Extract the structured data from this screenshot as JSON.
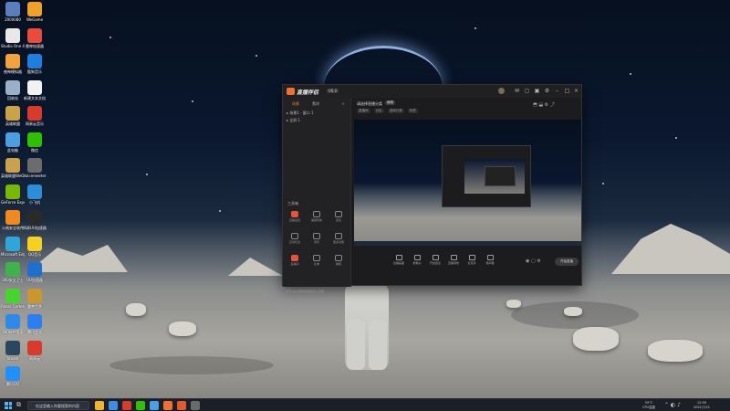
{
  "desktop": {
    "icons": [
      {
        "label": "2000080",
        "color": "#5a7fbf"
      },
      {
        "label": "Studio One 4",
        "color": "#e8e8e8"
      },
      {
        "label": "夜神模拟器",
        "color": "#f2a43a"
      },
      {
        "label": "回收站",
        "color": "#9ab0c8"
      },
      {
        "label": "英雄联盟",
        "color": "#c9a24a"
      },
      {
        "label": "此电脑",
        "color": "#4a9fe0"
      },
      {
        "label": "英雄联盟WeGame版",
        "color": "#c9a24a"
      },
      {
        "label": "GeForce Experience",
        "color": "#76b900"
      },
      {
        "label": "火绒安全软件",
        "color": "#f08a1e"
      },
      {
        "label": "Microsoft Edge",
        "color": "#2fa6d9"
      },
      {
        "label": "360安全卫士",
        "color": "#3db34a"
      },
      {
        "label": "Razer Cortex",
        "color": "#44d62c"
      },
      {
        "label": "360软件管家",
        "color": "#2e8ae6"
      },
      {
        "label": "Steam",
        "color": "#2a475e"
      },
      {
        "label": "腾讯QQ",
        "color": "#1e90ff"
      },
      {
        "label": "WeGame",
        "color": "#f0a12a"
      },
      {
        "label": "雷神加速器",
        "color": "#e94b3c"
      },
      {
        "label": "酷狗音乐",
        "color": "#1e7fe0"
      },
      {
        "label": "新建文本文档",
        "color": "#f2f2f2"
      },
      {
        "label": "网易云音乐",
        "color": "#d83b2b"
      },
      {
        "label": "微信",
        "color": "#2dc100"
      },
      {
        "label": "Voicemeeter",
        "color": "#6c6c6c"
      },
      {
        "label": "小飞机",
        "color": "#2a8fd6"
      },
      {
        "label": "网易UU加速器",
        "color": "#2a2a2a"
      },
      {
        "label": "QQ音乐",
        "color": "#f5d020"
      },
      {
        "label": "UU加速器",
        "color": "#1f6fd0"
      },
      {
        "label": "魔兽世界",
        "color": "#c9972d"
      },
      {
        "label": "腾讯会议",
        "color": "#2d7ff0"
      },
      {
        "label": "网易云",
        "color": "#d83b2b"
      }
    ]
  },
  "app": {
    "name": "直播伴侣",
    "version": "V6.0",
    "left_panel": {
      "tabs": [
        "场景",
        "素材"
      ],
      "active_tab": "场景",
      "sources": [
        "场景1",
        "窗口 1",
        "全屏 1"
      ],
      "tools_title": "工具箱",
      "tools": [
        {
          "label": "直播设置",
          "red": true
        },
        {
          "label": "美颜特效",
          "red": false
        },
        {
          "label": "连麦",
          "red": false
        },
        {
          "label": "互动玩法",
          "red": false
        },
        {
          "label": "音乐",
          "red": false
        },
        {
          "label": "更多功能",
          "red": false
        },
        {
          "label": "直播间",
          "red": true
        },
        {
          "label": "礼物",
          "red": false
        },
        {
          "label": "弹幕",
          "red": false
        }
      ],
      "notice": "你可以在直播时使用更多工具哦"
    },
    "main": {
      "room_title": "请选择直播分类",
      "room_badge": "编辑",
      "room_meta": [
        "直播间",
        "分区",
        "选择分类",
        "标签"
      ],
      "controls": [
        {
          "label": "直播画面"
        },
        {
          "label": "摄像头"
        },
        {
          "label": "开启连麦"
        },
        {
          "label": "直播特效"
        },
        {
          "label": "麦克风"
        },
        {
          "label": "扬声器"
        }
      ],
      "start_label": "开始直播"
    }
  },
  "taskbar": {
    "search_text": "在这里输入你要搜索的内容",
    "tray_text": "59°C\nCPU温度",
    "time": "12:59",
    "date": "2021/7/21",
    "apps": [
      {
        "color": "#f0b429"
      },
      {
        "color": "#3a8ee6"
      },
      {
        "color": "#d83b2b"
      },
      {
        "color": "#2dc100"
      },
      {
        "color": "#44a0e8"
      },
      {
        "color": "#f0702c"
      },
      {
        "color": "#e05a2a"
      },
      {
        "color": "#6a6a6a"
      }
    ]
  }
}
